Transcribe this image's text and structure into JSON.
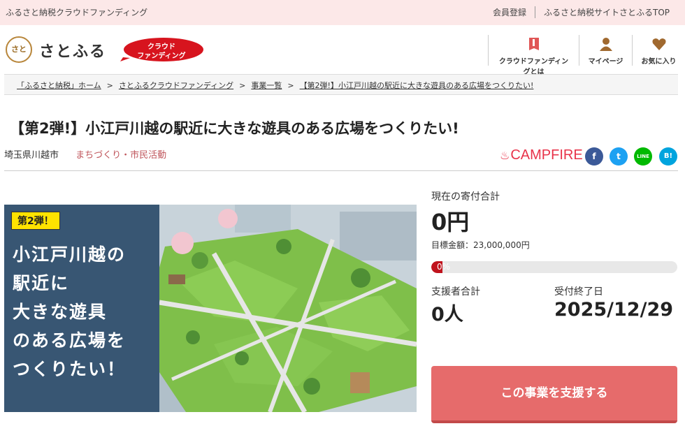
{
  "topbar": {
    "site_name": "ふるさと納税クラウドファンディング",
    "member_register": "会員登録",
    "satofull_top": "ふるさと納税サイトさとふるTOP"
  },
  "header": {
    "logo_mark": "さと",
    "logo_text": "さとふる",
    "badge_line1": "クラウド",
    "badge_line2": "ファンディング",
    "nav": {
      "about_cf": "クラウドファンディングとは",
      "mypage": "マイページ",
      "favorites": "お気に入り"
    }
  },
  "breadcrumb": {
    "items": [
      "「ふるさと納税」ホーム",
      "さとふるクラウドファンディング",
      "事業一覧",
      "【第2弾!】小江戸川越の駅近に大きな遊具のある広場をつくりたい!"
    ],
    "separator": ">"
  },
  "project": {
    "title": "【第2弾!】小江戸川越の駅近に大きな遊具のある広場をつくりたい!",
    "city": "埼玉県川越市",
    "category": "まちづくり・市民活動",
    "partner": "CAMPFIRE"
  },
  "social": {
    "facebook": "f",
    "twitter": "t",
    "line": "LINE",
    "hatena": "B!"
  },
  "hero": {
    "tag": "第2弾！",
    "lines": [
      "小江戸川越の",
      "駅近に",
      "大きな遊具",
      "のある広場を",
      "つくりたい！"
    ]
  },
  "stats": {
    "total_label": "現在の寄付合計",
    "total_value": "0円",
    "goal_text": "目標金額：23,000,000円",
    "progress_fraction": 0,
    "progress_text": "0%",
    "supporters_label": "支援者合計",
    "supporters_value": "0人",
    "deadline_label": "受付終了日",
    "deadline_value": "2025/12/29"
  },
  "cta": {
    "support_button": "この事業を支援する"
  },
  "colors": {
    "brand_red": "#e66b6b",
    "progress_red": "#c0131d",
    "topbar_bg": "#fce8e8",
    "category": "#c0575d"
  }
}
